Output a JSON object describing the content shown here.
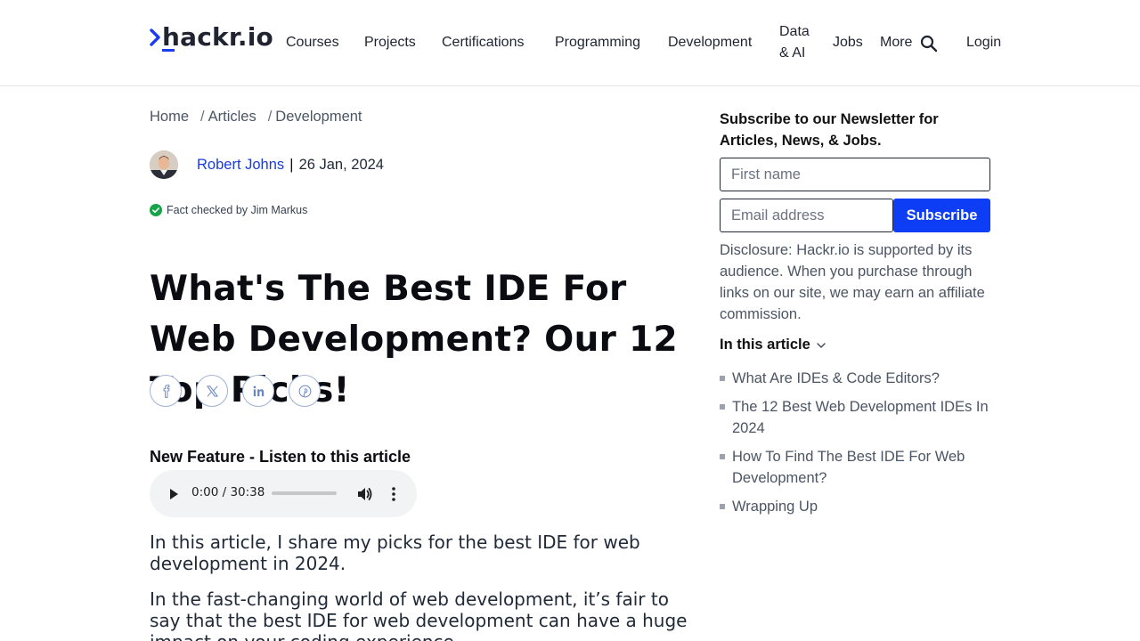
{
  "header": {
    "logo_text": "hackr.io",
    "nav": {
      "courses": "Courses",
      "projects": "Projects",
      "certifications": "Certifications",
      "programming": "Programming",
      "development": "Development",
      "data_ai_line1": "Data",
      "data_ai_line2": "& AI",
      "jobs": "Jobs",
      "more": "More",
      "login": "Login"
    }
  },
  "breadcrumb": {
    "home": "Home",
    "articles": "Articles",
    "development": "Development",
    "separator": "/"
  },
  "author": {
    "name": "Robert Johns",
    "separator": "|",
    "date": "26 Jan, 2024",
    "fact_checked": "Fact checked by Jim Markus"
  },
  "article": {
    "title": "What's The Best IDE For Web Development? Our 12 Top Picks!",
    "listen_label": "New Feature - Listen to this article",
    "audio_time": "0:00 / 30:38",
    "audio_progress": 0,
    "para1": "In this article, I share my picks for the best IDE for web development in 2024.",
    "para2": "In the fast-changing world of web development, it’s fair to say that the best IDE for web development can have a huge impact on your coding experience."
  },
  "share": [
    "facebook-icon",
    "x-icon",
    "linkedin-icon",
    "pinterest-icon"
  ],
  "sidebar": {
    "newsletter_heading": "Subscribe to our Newsletter for Articles, News, & Jobs.",
    "first_name_placeholder": "First name",
    "email_placeholder": "Email address",
    "subscribe_label": "Subscribe",
    "disclosure": "Disclosure: Hackr.io is supported by its audience. When you purchase through links on our site, we may earn an affiliate commission.",
    "toc_heading": "In this article",
    "toc": [
      "What Are IDEs & Code Editors?",
      "The 12 Best Web Development IDEs In 2024",
      "How To Find The Best IDE For Web Development?",
      "Wrapping Up"
    ]
  },
  "colors": {
    "accent": "#0d3ef5",
    "author_link": "#1a3cd8",
    "fact_check": "#16a34a"
  }
}
